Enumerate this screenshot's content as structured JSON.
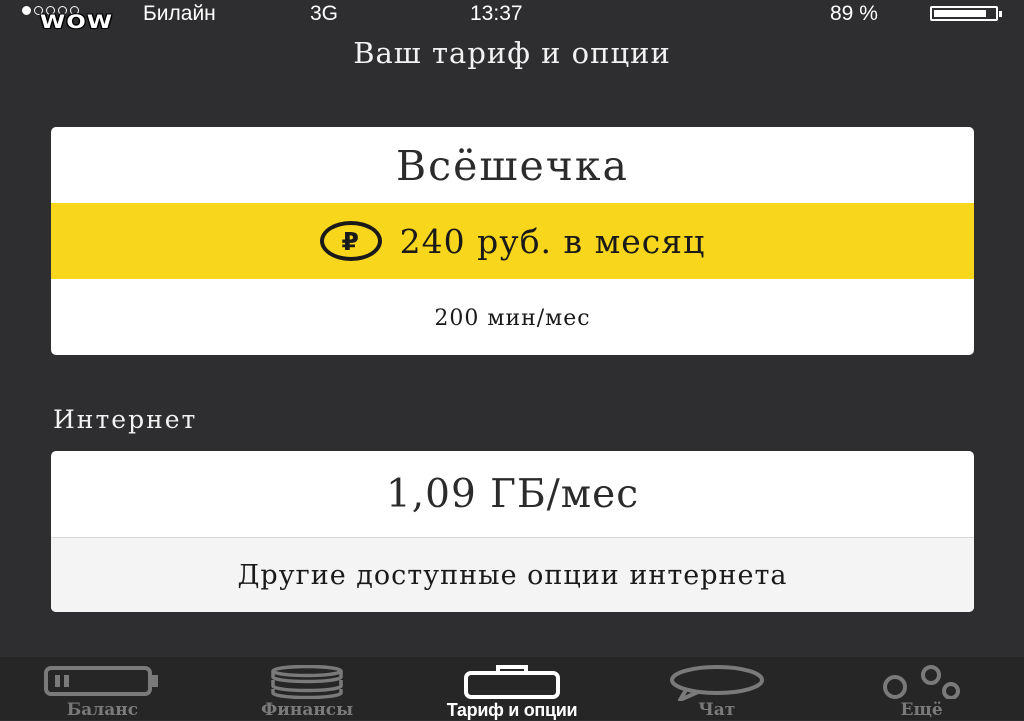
{
  "status_bar": {
    "watermark": "WOW",
    "carrier": "Билайн",
    "network": "3G",
    "time": "13:37",
    "battery": "89 %",
    "battery_level": 0.89
  },
  "page_title": "Ваш тариф и опции",
  "tariff": {
    "name": "Всёшечка",
    "price": "240 руб. в месяц",
    "currency_icon": "ruble-icon",
    "minutes": "200 мин/мес",
    "accent_color": "#f7d61b"
  },
  "internet": {
    "section_label": "Интернет",
    "volume": "1,09 ГБ/мес",
    "more_options": "Другие доступные опции интернета"
  },
  "tab_bar": {
    "tabs": [
      {
        "label": "Баланс",
        "icon": "battery-icon",
        "active": false
      },
      {
        "label": "Финансы",
        "icon": "coins-icon",
        "active": false
      },
      {
        "label": "Тариф и опции",
        "icon": "briefcase-icon",
        "active": true
      },
      {
        "label": "Чат",
        "icon": "chat-bubble-icon",
        "active": false
      },
      {
        "label": "Ещё",
        "icon": "more-circles-icon",
        "active": false
      }
    ]
  }
}
